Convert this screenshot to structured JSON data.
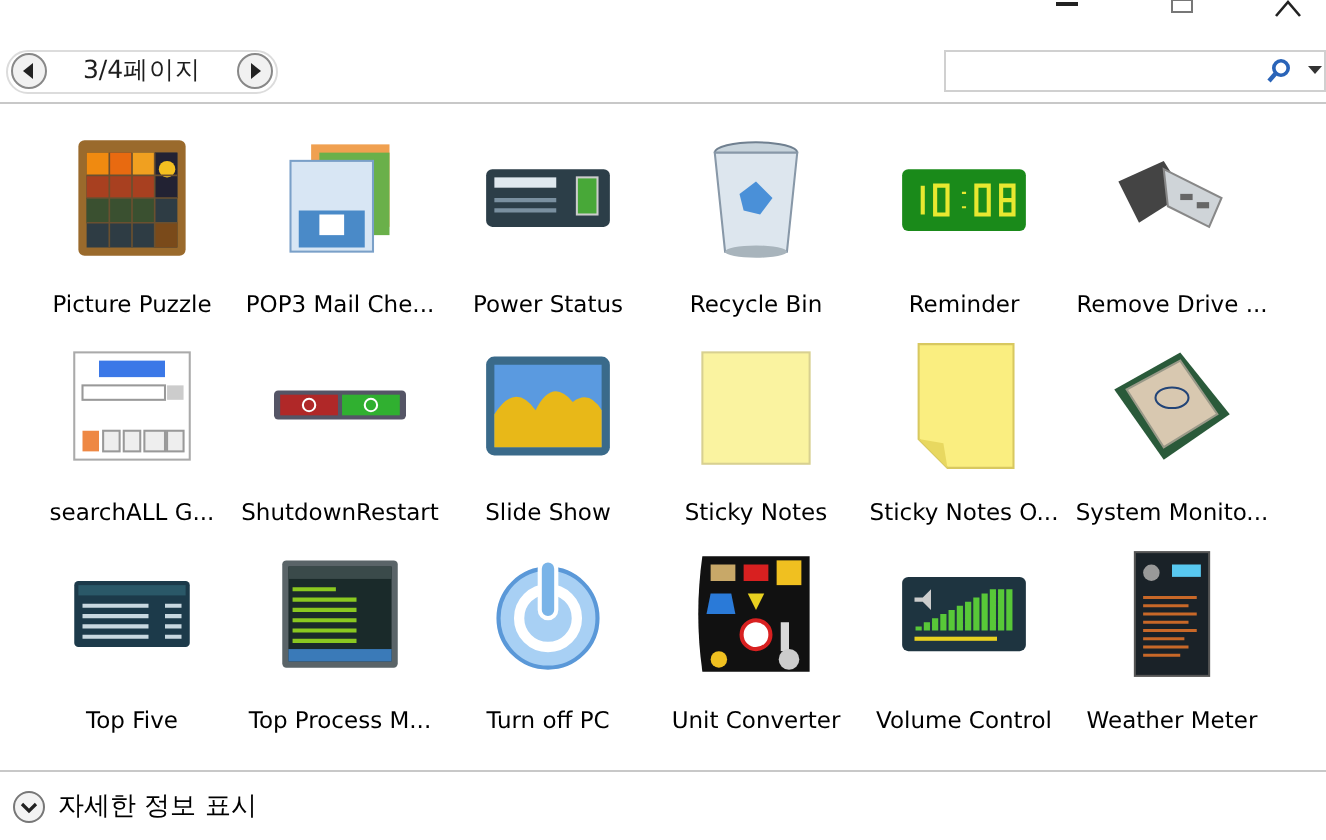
{
  "pager": {
    "label": "3/4페이지"
  },
  "gadgets": [
    {
      "name": "Picture Puzzle"
    },
    {
      "name": "POP3 Mail Che..."
    },
    {
      "name": "Power Status"
    },
    {
      "name": "Recycle Bin"
    },
    {
      "name": "Reminder"
    },
    {
      "name": "Remove Drive ..."
    },
    {
      "name": "searchALL G..."
    },
    {
      "name": "ShutdownRestart"
    },
    {
      "name": "Slide Show"
    },
    {
      "name": "Sticky Notes"
    },
    {
      "name": "Sticky Notes O..."
    },
    {
      "name": "System Monito..."
    },
    {
      "name": "Top Five"
    },
    {
      "name": "Top Process M..."
    },
    {
      "name": "Turn off PC"
    },
    {
      "name": "Unit Converter"
    },
    {
      "name": "Volume Control"
    },
    {
      "name": "Weather Meter"
    }
  ],
  "details_toggle": {
    "label": "자세한 정보 표시",
    "expanded": false
  }
}
